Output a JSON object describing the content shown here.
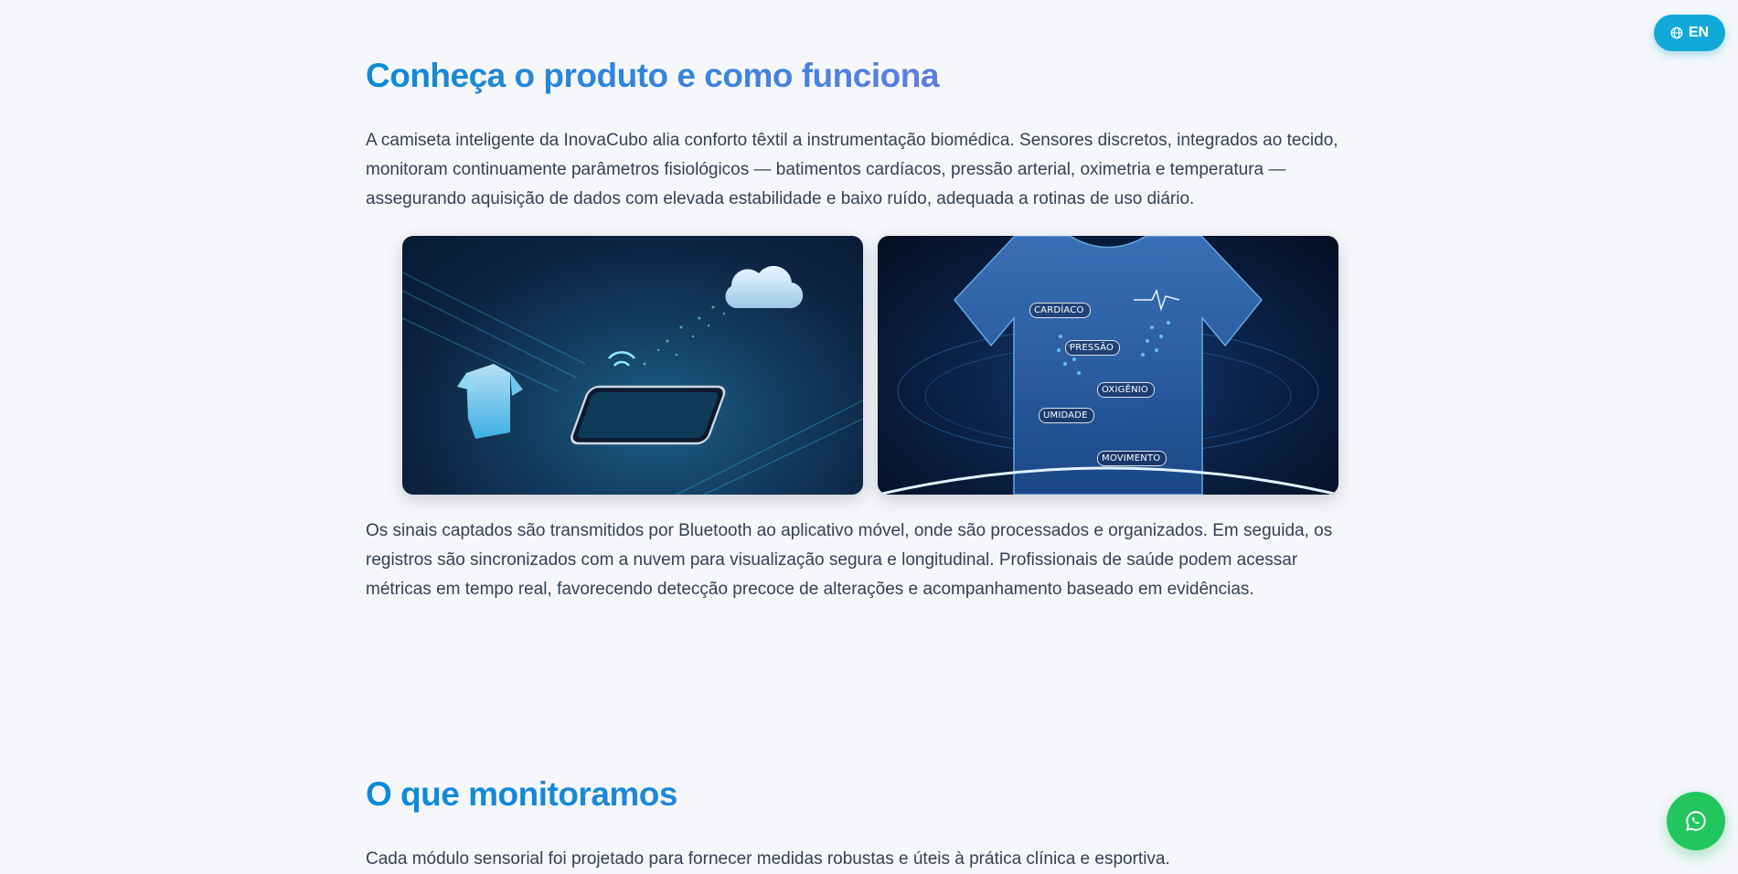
{
  "language_button": {
    "label": "EN",
    "icon": "globe-icon"
  },
  "intro": {
    "title": "Conheça o produto e como funciona",
    "paragraph1_line1": "A camiseta inteligente da InovaCubo alia conforto têxtil a instrumentação biomédica. Sensores discretos, integrados ao tecido,",
    "paragraph1_line2": "monitoram continuamente parâmetros fisiológicos — batimentos cardíacos, pressão arterial, oximetria e temperatura —",
    "paragraph1_line3": "assegurando aquisição de dados com elevada estabilidade e baixo ruído, adequada a rotinas de uso diário.",
    "paragraph2_line1": "Os sinais captados são transmitidos por Bluetooth ao aplicativo móvel, onde são processados e organizados. Em seguida, os",
    "paragraph2_line2": "registros são sincronizados com a nuvem para visualização segura e longitudinal. Profissionais de saúde podem acessar",
    "paragraph2_line3": "métricas em tempo real, favorecendo detecção precoce de alterações e acompanhamento baseado em evidências."
  },
  "images": {
    "right_labels": {
      "cardiac": "CARDÍACO",
      "pressure": "PRESSÃO",
      "oxygen": "OXIGÊNIO",
      "humidity": "UMIDADE",
      "movement": "MOVIMENTO"
    }
  },
  "monitoring": {
    "title": "O que monitoramos",
    "paragraph": "Cada módulo sensorial foi projetado para fornecer medidas robustas e úteis à prática clínica e esportiva."
  },
  "whatsapp": {
    "icon": "whatsapp-icon"
  }
}
